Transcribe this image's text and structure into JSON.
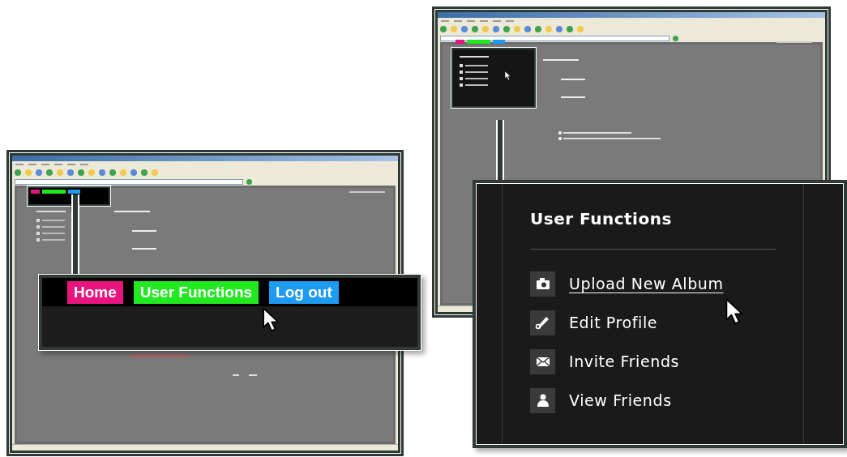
{
  "left_callout": {
    "nav": [
      {
        "label": "Home",
        "color": "#e8157e"
      },
      {
        "label": "User Functions",
        "color": "#22e822"
      },
      {
        "label": "Log out",
        "color": "#1e9af0"
      }
    ]
  },
  "right_callout": {
    "title": "User Functions",
    "items": [
      {
        "label": "Upload New Album",
        "kind": "camera",
        "underlined": true
      },
      {
        "label": "Edit Profile",
        "kind": "pencil",
        "underlined": false
      },
      {
        "label": "Invite Friends",
        "kind": "envelope",
        "underlined": false
      },
      {
        "label": "View Friends",
        "kind": "person",
        "underlined": false
      }
    ]
  }
}
